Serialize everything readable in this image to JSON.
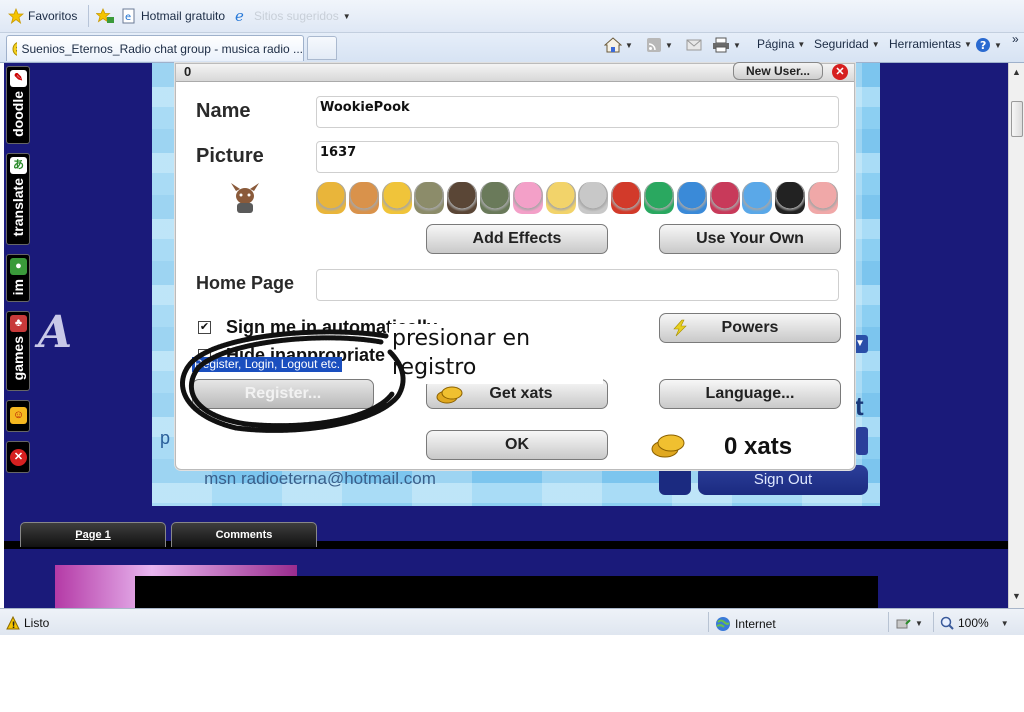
{
  "browser": {
    "favorites_label": "Favoritos",
    "hotmail_label": "Hotmail gratuito",
    "suggested_label": "Sitios sugeridos",
    "tab_title": "Suenios_Eternos_Radio chat group - musica radio ...",
    "commands": {
      "page": "Página",
      "safety": "Seguridad",
      "tools": "Herramientas"
    },
    "more_chevron": "»"
  },
  "sidebar": {
    "items": [
      {
        "label": "doodle",
        "icon": "doodle-icon"
      },
      {
        "label": "translate",
        "icon": "translate-icon"
      },
      {
        "label": "im",
        "icon": "people-icon"
      },
      {
        "label": "games",
        "icon": "games-icon"
      }
    ],
    "chat_logo_glyph": "A"
  },
  "chat": {
    "msn": "msn radioeterna@hotmail.com",
    "sign_out": "Sign Out",
    "partial_letter": "t",
    "partial_p": "p"
  },
  "page_tabs": {
    "page1": "Page 1",
    "comments": "Comments"
  },
  "dialog": {
    "top_value": "0",
    "new_user": "New User...",
    "name_label": "Name",
    "name_value": "WookiePook",
    "picture_label": "Picture",
    "picture_value": "1637",
    "add_effects": "Add Effects",
    "use_your_own": "Use Your Own",
    "home_page_label": "Home Page",
    "sign_in_auto": "Sign me in automatically",
    "hide_inappropriate": "Hide inappropriate",
    "powers": "Powers",
    "tooltip": "Register, Login, Logout etc.",
    "register": "Register...",
    "get_xats": "Get xats",
    "language": "Language...",
    "ok": "OK",
    "xats_balance": "0 xats",
    "checkbox_mark": "✔",
    "avatar_colors": [
      "#e9b53a",
      "#d9924b",
      "#f0c43a",
      "#8c8c6a",
      "#5a4636",
      "#6a7a5a",
      "#f3a0c8",
      "#f2d36a",
      "#c8c8c8",
      "#d23a2a",
      "#2aa860",
      "#3a8ad8",
      "#c83a5a",
      "#5aa8e8",
      "#222222",
      "#f0a8a8"
    ]
  },
  "annotation": {
    "line1": "presionar en",
    "line2": "registro"
  },
  "statusbar": {
    "status": "Listo",
    "zone": "Internet",
    "zoom": "100%"
  }
}
